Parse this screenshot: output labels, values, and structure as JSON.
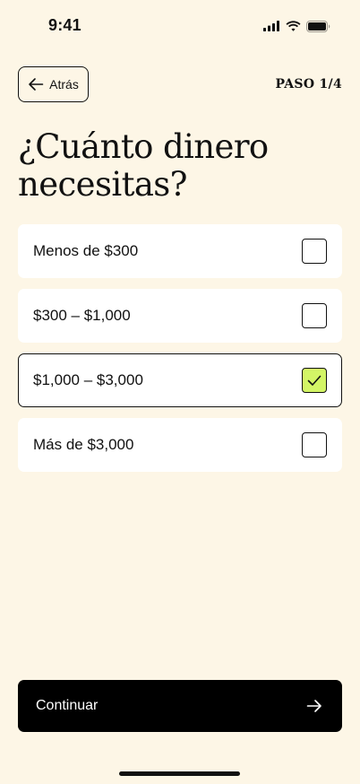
{
  "status_bar": {
    "time": "9:41",
    "icons": [
      "cellular-signal-icon",
      "wifi-icon",
      "battery-icon"
    ]
  },
  "header": {
    "back_label": "Atrás",
    "back_icon": "arrow-left-icon",
    "step_label": "PASO 1/4"
  },
  "title": "¿Cuánto dinero necesitas?",
  "options": [
    {
      "label": "Menos de $300",
      "selected": false
    },
    {
      "label": "$300 – $1,000",
      "selected": false
    },
    {
      "label": "$1,000 – $3,000",
      "selected": true
    },
    {
      "label": "Más de $3,000",
      "selected": false
    }
  ],
  "footer": {
    "continue_label": "Continuar",
    "continue_icon": "arrow-right-icon"
  },
  "colors": {
    "background": "#fdf6e6",
    "card": "#ffffff",
    "accent_check": "#d3f566",
    "primary_button": "#000000",
    "text": "#111111"
  }
}
